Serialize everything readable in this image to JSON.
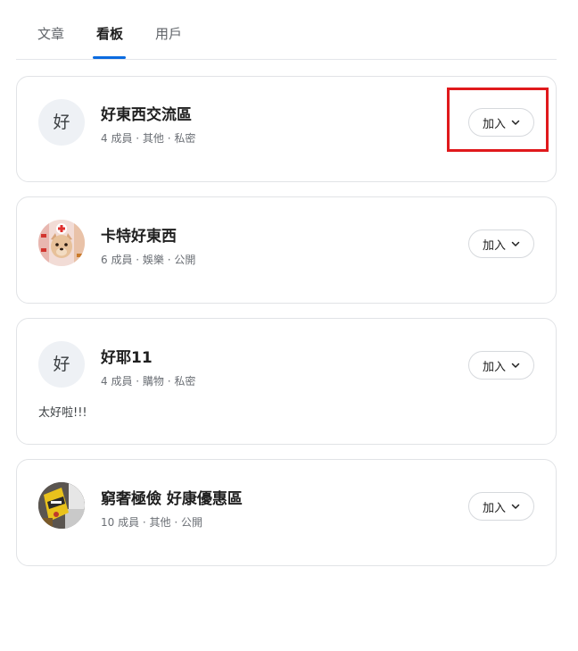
{
  "tabs": [
    {
      "label": "文章"
    },
    {
      "label": "看板"
    },
    {
      "label": "用戶"
    }
  ],
  "active_tab": "看板",
  "boards": [
    {
      "avatar_letter": "好",
      "name": "好東西交流區",
      "meta": "4 成員 · 其他 · 私密",
      "description": "",
      "join_label": "加入"
    },
    {
      "avatar_letter": "",
      "name": "卡特好東西",
      "meta": "6 成員 · 娛樂 · 公開",
      "description": "",
      "join_label": "加入"
    },
    {
      "avatar_letter": "好",
      "name": "好耶11",
      "meta": "4 成員 · 購物 · 私密",
      "description": "太好啦!!!",
      "join_label": "加入"
    },
    {
      "avatar_letter": "",
      "name": "窮奢極儉 好康優惠區",
      "meta": "10 成員 · 其他 · 公開",
      "description": "",
      "join_label": "加入"
    }
  ],
  "colors": {
    "accent": "#0b6be0",
    "highlight_box": "#e0191c",
    "card_border": "#e1e3e6",
    "muted_text": "#6b6f75"
  }
}
